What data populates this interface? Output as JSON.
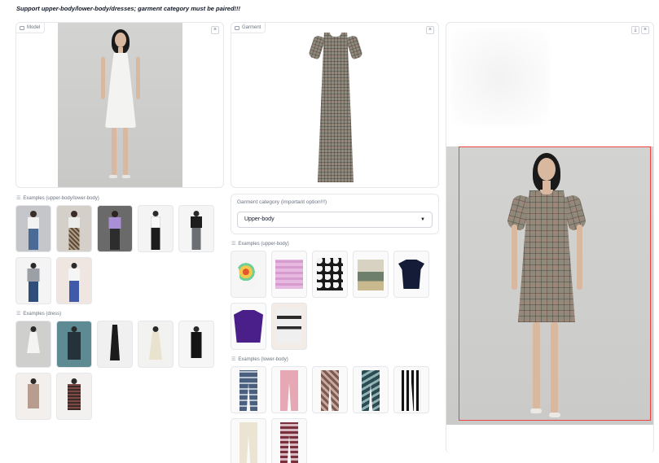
{
  "banner": "Support upper-body/lower-body/dresses; garment category must be paired!!!",
  "model_panel": {
    "tag": "Model"
  },
  "garment_panel": {
    "tag": "Garment"
  },
  "close_symbol": "×",
  "download_symbol": "⤓",
  "garment_category": {
    "label": "Garment category (important option!!!)",
    "selected": "Upper-body",
    "caret": "▼"
  },
  "examples": {
    "model_upper_lower": {
      "label": "Examples (upper-body/lower-body)",
      "count": 7
    },
    "model_dress": {
      "label": "Examples (dress)",
      "count": 7
    },
    "garment_upper": {
      "label": "Examples (upper-body)",
      "count": 7
    },
    "garment_lower": {
      "label": "Examples (lower-body)",
      "count": 7
    }
  },
  "colors": {
    "accent_box": "#ef4444",
    "border": "#e5e7eb",
    "studio_bg": "#d4d4d4"
  }
}
